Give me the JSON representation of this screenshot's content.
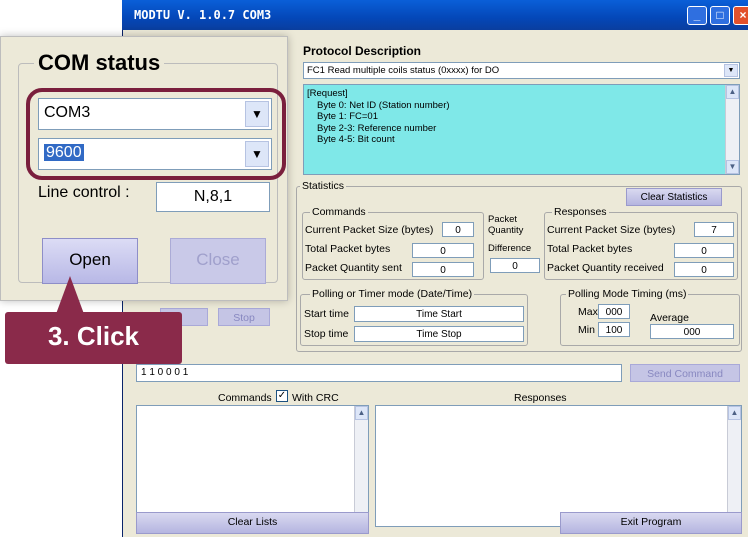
{
  "window": {
    "title": "MODTU  V. 1.0.7  COM3"
  },
  "protocol": {
    "header": "Protocol Description",
    "selected": "FC1  Read multiple coils status (0xxxx)  for DO",
    "description_lines": [
      "[Request]",
      "Byte 0:      Net ID (Station number)",
      "Byte 1:      FC=01",
      "Byte 2-3:    Reference number",
      "Byte 4-5:    Bit count"
    ]
  },
  "statistics": {
    "label": "Statistics",
    "clear_button": "Clear Statistics",
    "commands_title": "Commands",
    "current_packet_label": "Current Packet Size (bytes)",
    "current_packet_value": "0",
    "total_packet_label": "Total Packet bytes",
    "total_packet_value": "0",
    "packet_sent_label": "Packet Quantity sent",
    "packet_sent_value": "0",
    "packet_quantity_label_1": "Packet",
    "packet_quantity_label_2": "Quantity",
    "difference_label": "Difference",
    "difference_value": "0",
    "responses_title": "Responses",
    "resp_current_label": "Current Packet Size (bytes)",
    "resp_current_value": "7",
    "resp_total_label": "Total Packet bytes",
    "resp_total_value": "0",
    "resp_received_label": "Packet Quantity received",
    "resp_received_value": "0"
  },
  "polling": {
    "title": "Polling  or Timer mode  (Date/Time)",
    "start_label": "Start time",
    "start_value": "Time Start",
    "stop_label": "Stop time",
    "stop_value": "Time Stop",
    "timing_title": "Polling Mode Timing (ms)",
    "max_label": "Max",
    "max_value": "000",
    "min_label": "Min",
    "min_value": "100",
    "average_label": "Average",
    "average_value": "000"
  },
  "stop_button": "Stop",
  "command_input": "1 1 0 0 0 1",
  "send_button": "Send Command",
  "commands_label": "Commands",
  "with_crc_label": "With CRC",
  "responses_label": "Responses",
  "clear_lists_button": "Clear Lists",
  "exit_button": "Exit Program",
  "com_status": {
    "title": "COM status",
    "port": "COM3",
    "baud": "9600",
    "line_control_label": "Line control :",
    "line_control_value": "N,8,1",
    "open_button": "Open",
    "close_button": "Close"
  },
  "callout": {
    "text": "3. Click"
  },
  "colors": {
    "accent": "#8a2a4a",
    "cyan": "#7fe8e8",
    "titlebar": "#0a5fd8"
  }
}
